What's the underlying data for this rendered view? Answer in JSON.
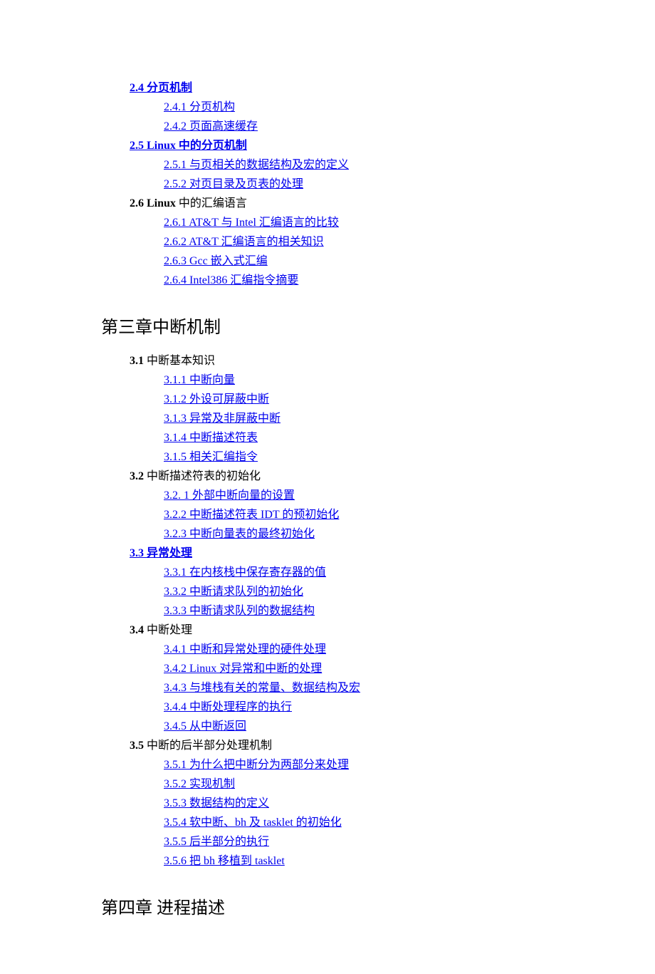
{
  "toc": {
    "s24": {
      "num": "2.4",
      "title": "分页机制",
      "items": [
        {
          "num": "2.4.1",
          "title": "分页机构"
        },
        {
          "num": "2.4.2",
          "title": "页面高速缓存"
        }
      ]
    },
    "s25": {
      "num": "2.5",
      "title_full": "2.5 Linux 中的分页机制",
      "items": [
        {
          "num": "2.5.1",
          "title": "与页相关的数据结构及宏的定义"
        },
        {
          "num": "2.5.2",
          "title": "对页目录及页表的处理"
        }
      ]
    },
    "s26": {
      "num": "2.6",
      "title_bold": "2.6 Linux",
      "title_rest": " 中的汇编语言",
      "items": [
        {
          "num": "2.6.1",
          "title": "AT&T 与 Intel 汇编语言的比较"
        },
        {
          "num": "2.6.2",
          "title": "AT&T 汇编语言的相关知识"
        },
        {
          "num": "2.6.3",
          "title": "Gcc 嵌入式汇编"
        },
        {
          "num": "2.6.4",
          "title": "Intel386 汇编指令摘要"
        }
      ]
    },
    "chapter3": "第三章中断机制",
    "s31": {
      "num": "3.1",
      "title": "中断基本知识",
      "items": [
        {
          "num": "3.1.1",
          "title": "中断向量"
        },
        {
          "num": "3.1.2",
          "title": "外设可屏蔽中断"
        },
        {
          "num": "3.1.3",
          "title": "异常及非屏蔽中断"
        },
        {
          "num": "3.1.4",
          "title": "中断描述符表"
        },
        {
          "num": "3.1.5",
          "title": "相关汇编指令"
        }
      ]
    },
    "s32": {
      "num": "3.2",
      "title": "中断描述符表的初始化",
      "items": [
        {
          "num": "3.2. 1",
          "title": "外部中断向量的设置"
        },
        {
          "num": "3.2.2",
          "title": "中断描述符表 IDT 的预初始化"
        },
        {
          "num": "3.2.3",
          "title": "中断向量表的最终初始化"
        }
      ]
    },
    "s33": {
      "num": "3.3",
      "title": "异常处理",
      "items": [
        {
          "num": "3.3.1",
          "title": "在内核栈中保存寄存器的值"
        },
        {
          "num": "3.3.2",
          "title": "中断请求队列的初始化"
        },
        {
          "num": "3.3.3",
          "title": "中断请求队列的数据结构"
        }
      ]
    },
    "s34": {
      "num": "3.4",
      "title": "中断处理",
      "items": [
        {
          "num": "3.4.1",
          "title": "中断和异常处理的硬件处理"
        },
        {
          "num": "3.4.2",
          "title": "Linux 对异常和中断的处理"
        },
        {
          "num": "3.4.3",
          "title": "与堆栈有关的常量、数据结构及宏"
        },
        {
          "num": "3.4.4",
          "title": "中断处理程序的执行"
        },
        {
          "num": "3.4.5",
          "title": "从中断返回"
        }
      ]
    },
    "s35": {
      "num": "3.5",
      "title": "中断的后半部分处理机制",
      "items": [
        {
          "num": "3.5.1",
          "title": "为什么把中断分为两部分来处理"
        },
        {
          "num": "3.5.2",
          "title": "实现机制"
        },
        {
          "num": "3.5.3",
          "title": "数据结构的定义"
        },
        {
          "num": "3.5.4",
          "title": "软中断、bh 及 tasklet 的初始化"
        },
        {
          "num": "3.5.5",
          "title": "后半部分的执行"
        },
        {
          "num": "3.5.6",
          "title": "把 bh 移植到 tasklet"
        }
      ]
    },
    "chapter4": "第四章  进程描述"
  }
}
